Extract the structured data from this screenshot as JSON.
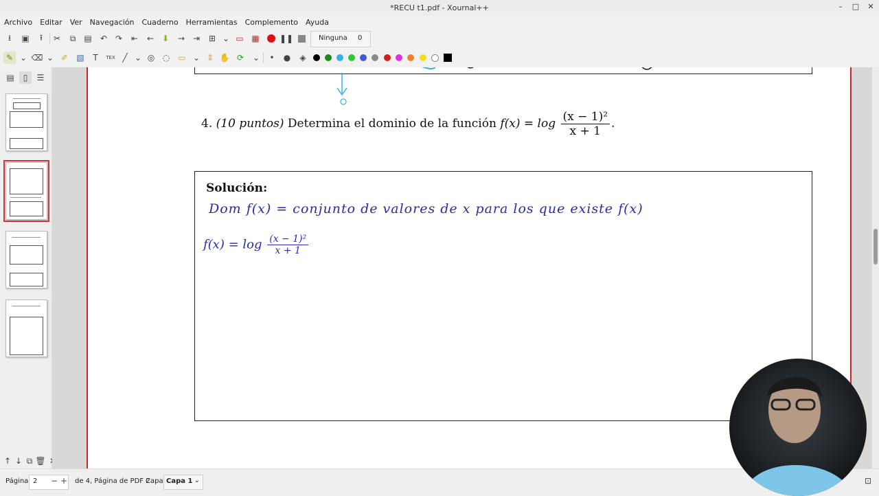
{
  "window": {
    "title": "*RECU t1.pdf - Xournal++",
    "minimize": "–",
    "maximize": "□",
    "close": "✕"
  },
  "menu": [
    "Archivo",
    "Editar",
    "Ver",
    "Navegación",
    "Cuaderno",
    "Herramientas",
    "Complemento",
    "Ayuda"
  ],
  "toolbar": {
    "layer_label": "Ninguna",
    "layer_count": "0",
    "color_palette": [
      "#000000",
      "#111111",
      "#1a8a1a",
      "#35b1e8",
      "#2ec92e",
      "#3a5bd9",
      "#8a8a8a",
      "#d02020",
      "#e030e0",
      "#f08030",
      "#f0e020",
      "#ffffff",
      "#000000"
    ]
  },
  "document": {
    "problem_number": "4.",
    "problem_points": "(10 puntos)",
    "problem_text": "Determina el dominio de la función",
    "formula_lhs": "f(x) = log",
    "formula_num": "(x − 1)²",
    "formula_den": "x + 1",
    "formula_end": ".",
    "solution_label": "Solución:",
    "handwriting_line1": "Dom f(x) = conjunto de valores de x para los que existe f(x)",
    "handwriting_lhs": "f(x) = log",
    "handwriting_num": "(x − 1)²",
    "handwriting_den": "x + 1"
  },
  "statusbar": {
    "page_label": "Página",
    "page_value": "2",
    "page_of": "de 4, Página de PDF 2",
    "layer_label": "Capa",
    "layer_value": "Capa 1"
  }
}
